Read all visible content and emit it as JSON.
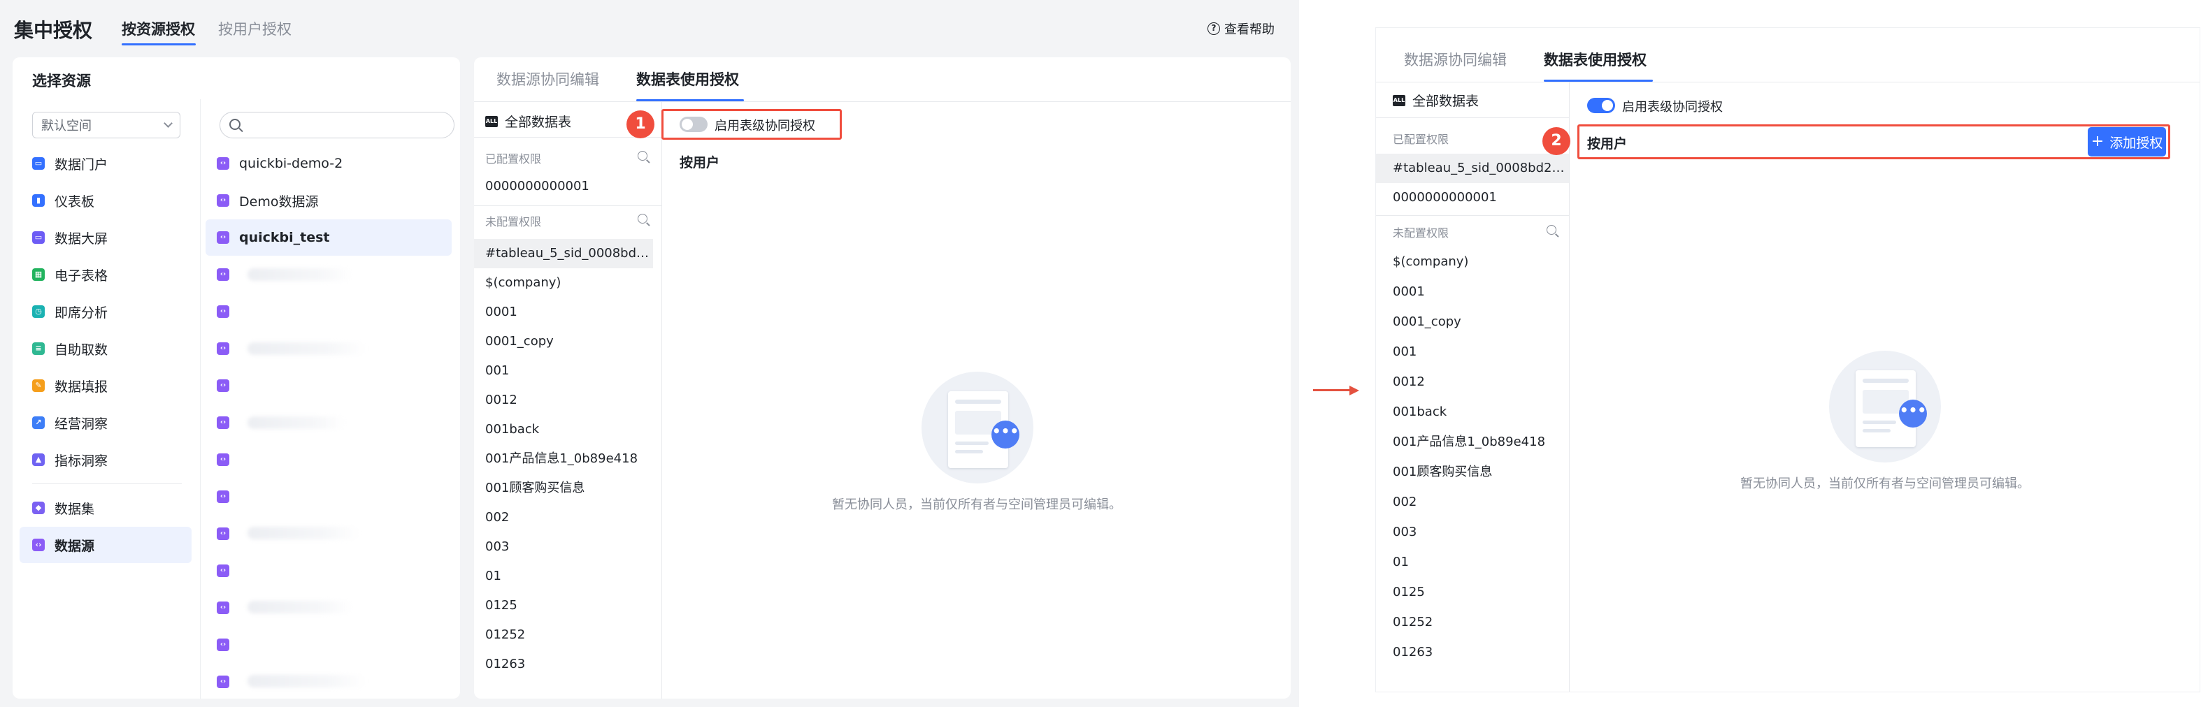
{
  "app": {
    "title": "集中授权",
    "tabs": [
      "按资源授权",
      "按用户授权"
    ],
    "help": "查看帮助"
  },
  "resource_panel": {
    "title": "选择资源",
    "space_select": "默认空间",
    "search_placeholder": "",
    "categories": [
      "数据门户",
      "仪表板",
      "数据大屏",
      "电子表格",
      "即席分析",
      "自助取数",
      "数据填报",
      "经营洞察",
      "指标洞察",
      "数据集",
      "数据源"
    ],
    "datasources": [
      "quickbi-demo-2",
      "Demo数据源",
      "quickbi_test"
    ]
  },
  "auth_panel": {
    "tabs": [
      "数据源协同编辑",
      "数据表使用授权"
    ],
    "all_tables": "全部数据表",
    "configured_label": "已配置权限",
    "unconfigured_label": "未配置权限",
    "toggle_label": "启用表级协同授权",
    "by_user": "按用户",
    "empty_text": "暂无协同人员，当前仅所有者与空间管理员可编辑。",
    "add_button": "添加授权"
  },
  "left_tables": {
    "configured": [
      "0000000000001"
    ],
    "unconfigured": [
      "#tableau_5_sid_0008bd2...",
      "$(company)",
      "0001",
      "0001_copy",
      "001",
      "0012",
      "001back",
      "001产品信息1_0b89e418",
      "001顾客购买信息",
      "002",
      "003",
      "01",
      "0125",
      "01252",
      "01263"
    ]
  },
  "right_tables": {
    "configured": [
      "#tableau_5_sid_0008bd2b...",
      "0000000000001"
    ],
    "unconfigured": [
      "$(company)",
      "0001",
      "0001_copy",
      "001",
      "0012",
      "001back",
      "001产品信息1_0b89e418",
      "001顾客购买信息",
      "002",
      "003",
      "01",
      "0125",
      "01252",
      "01263"
    ]
  },
  "steps": [
    "1",
    "2"
  ],
  "colors": {
    "accent": "#3370ff",
    "highlight": "#f04d3d",
    "selected_bg": "#edf2fe"
  }
}
